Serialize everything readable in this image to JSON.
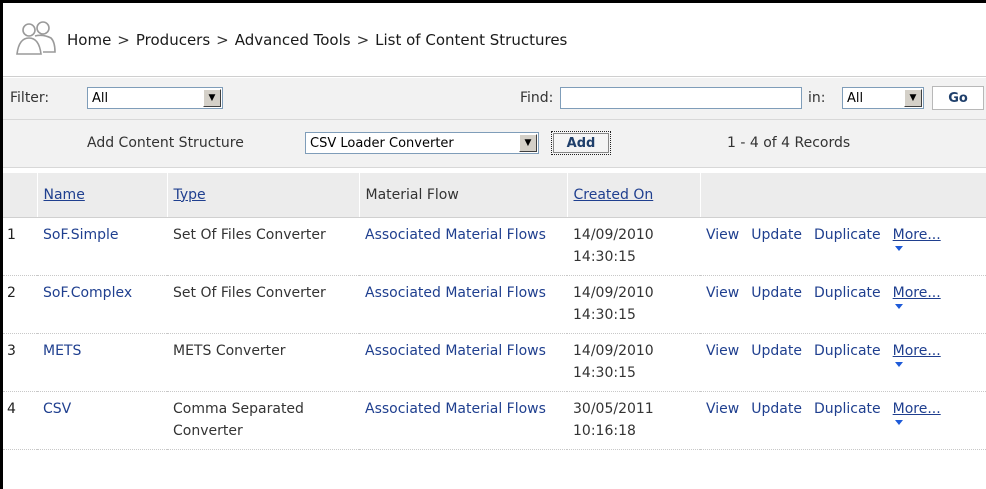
{
  "breadcrumb": {
    "items": [
      "Home",
      "Producers",
      "Advanced Tools",
      "List of Content Structures"
    ],
    "separator": ">"
  },
  "filter": {
    "label": "Filter:",
    "value": "All",
    "find_label": "Find:",
    "find_value": "",
    "in_label": "in:",
    "in_value": "All",
    "go_label": "Go"
  },
  "add": {
    "label": "Add Content Structure",
    "select_value": "CSV Loader Converter",
    "button_label": "Add",
    "records": "1 - 4 of 4 Records"
  },
  "table": {
    "headers": {
      "name": "Name",
      "type": "Type",
      "material_flow": "Material Flow",
      "created_on": "Created On"
    },
    "rows": [
      {
        "num": "1",
        "name": "SoF.Simple",
        "type": "Set Of Files Converter",
        "flow": "Associated Material Flows",
        "created": "14/09/2010 14:30:15"
      },
      {
        "num": "2",
        "name": "SoF.Complex",
        "type": "Set Of Files Converter",
        "flow": "Associated Material Flows",
        "created": "14/09/2010 14:30:15"
      },
      {
        "num": "3",
        "name": "METS",
        "type": "METS Converter",
        "flow": "Associated Material Flows",
        "created": "14/09/2010 14:30:15"
      },
      {
        "num": "4",
        "name": "CSV",
        "type": "Comma Separated Converter",
        "flow": "Associated Material Flows",
        "created": "30/05/2011 10:16:18"
      }
    ],
    "actions": {
      "view": "View",
      "update": "Update",
      "duplicate": "Duplicate",
      "more": "More..."
    }
  },
  "icons": {
    "header": "users-icon",
    "dropdown": "chevron-down-icon",
    "more": "caret-down-icon"
  },
  "colors": {
    "link": "#1f3f8f",
    "header_bg": "#ececec",
    "bar_bg": "#f2f2f2"
  }
}
